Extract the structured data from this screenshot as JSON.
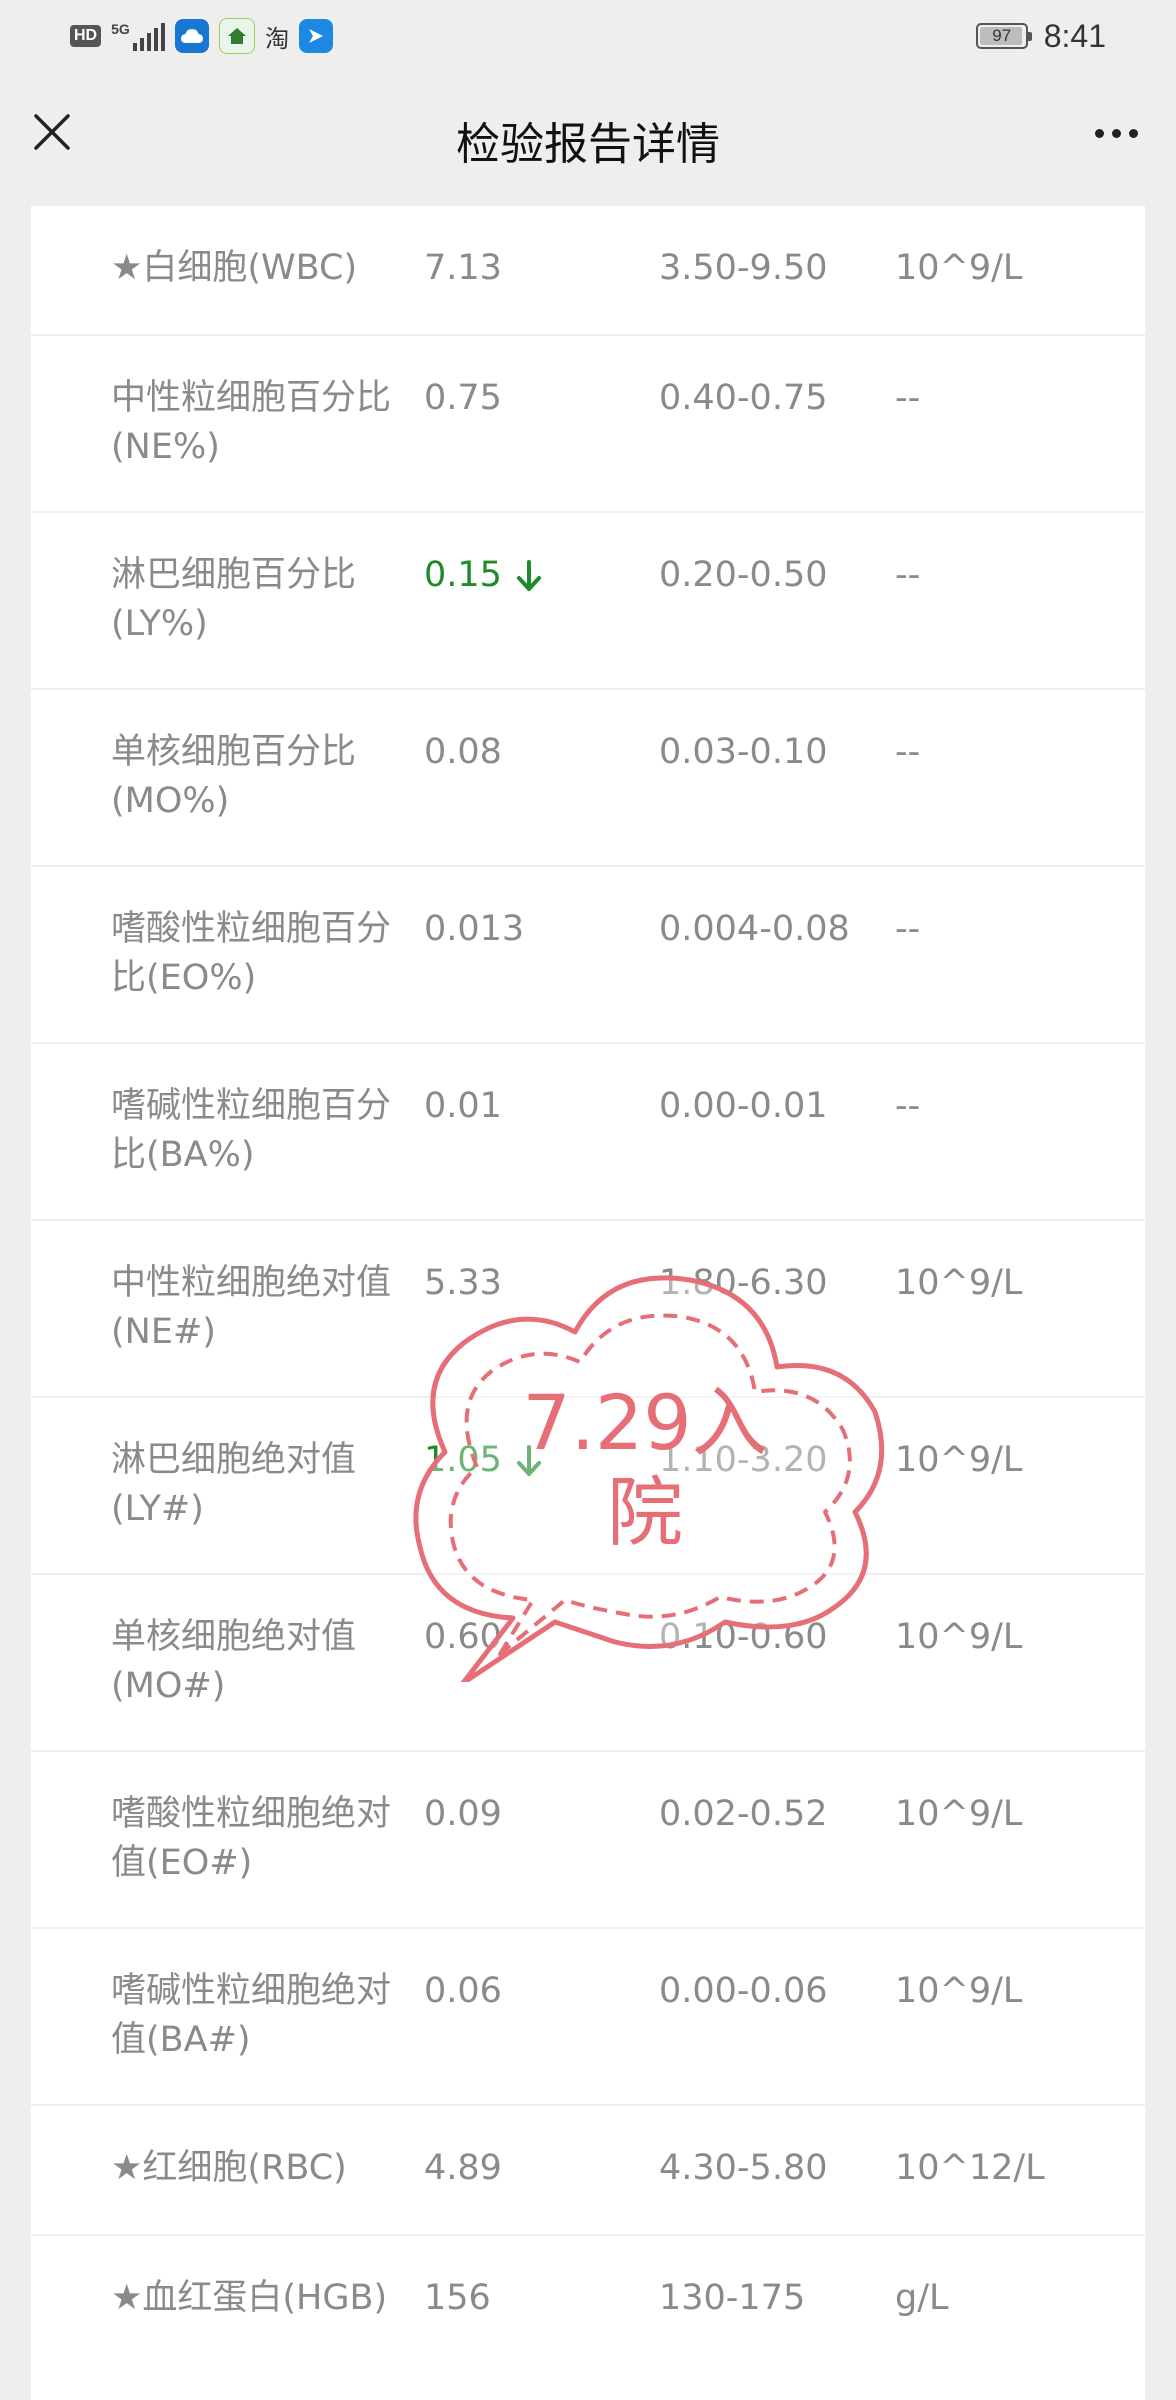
{
  "status_bar": {
    "hd": "HD",
    "network": "5G",
    "taobao": "淘",
    "battery": "97",
    "battery_level": 0.97,
    "time": "8:41"
  },
  "header": {
    "title": "检验报告详情",
    "close_icon": "close-icon",
    "more_icon": "more-icon"
  },
  "rows": [
    {
      "name": "★白细胞(WBC)",
      "value": "7.13",
      "ref": "3.50-9.50",
      "unit": "10^9/L",
      "flag": ""
    },
    {
      "name": "中性粒细胞百分比(NE%)",
      "value": "0.75",
      "ref": "0.40-0.75",
      "unit": "--",
      "flag": ""
    },
    {
      "name": "淋巴细胞百分比(LY%)",
      "value": "0.15",
      "ref": "0.20-0.50",
      "unit": "--",
      "flag": "low"
    },
    {
      "name": "单核细胞百分比(MO%)",
      "value": "0.08",
      "ref": "0.03-0.10",
      "unit": "--",
      "flag": ""
    },
    {
      "name": "嗜酸性粒细胞百分比(EO%)",
      "value": "0.013",
      "ref": "0.004-0.08",
      "unit": "--",
      "flag": ""
    },
    {
      "name": "嗜碱性粒细胞百分比(BA%)",
      "value": "0.01",
      "ref": "0.00-0.01",
      "unit": "--",
      "flag": ""
    },
    {
      "name": "中性粒细胞绝对值(NE#)",
      "value": "5.33",
      "ref": "1.80-6.30",
      "unit": "10^9/L",
      "flag": ""
    },
    {
      "name": "淋巴细胞绝对值(LY#)",
      "value": "1.05",
      "ref": "1.10-3.20",
      "unit": "10^9/L",
      "flag": "low"
    },
    {
      "name": "单核细胞绝对值(MO#)",
      "value": "0.60",
      "ref": "0.10-0.60",
      "unit": "10^9/L",
      "flag": ""
    },
    {
      "name": "嗜酸性粒细胞绝对值(EO#)",
      "value": "0.09",
      "ref": "0.02-0.52",
      "unit": "10^9/L",
      "flag": ""
    },
    {
      "name": "嗜碱性粒细胞绝对值(BA#)",
      "value": "0.06",
      "ref": "0.00-0.06",
      "unit": "10^9/L",
      "flag": ""
    },
    {
      "name": "★红细胞(RBC)",
      "value": "4.89",
      "ref": "4.30-5.80",
      "unit": "10^12/L",
      "flag": ""
    },
    {
      "name": "★血红蛋白(HGB)",
      "value": "156",
      "ref": "130-175",
      "unit": "g/L",
      "flag": ""
    }
  ],
  "stamp": {
    "line1": "7.29入",
    "line2": "院",
    "color": "#e66e77"
  },
  "colors": {
    "low": "#1f8a2a",
    "text": "#8a8a8a"
  }
}
